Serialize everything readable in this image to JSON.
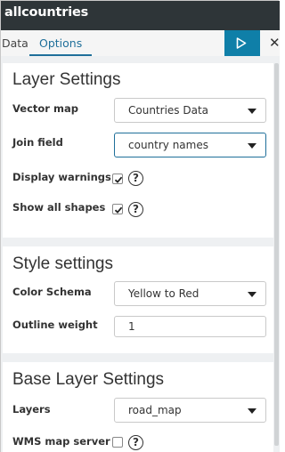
{
  "title": "allcountries",
  "tabs": [
    {
      "label": "Data"
    },
    {
      "label": "Options",
      "active": true
    }
  ],
  "icons": {
    "apply": "play-icon",
    "close": "close-icon"
  },
  "accent_color": "#0f7fa8",
  "sections": {
    "layer": {
      "title": "Layer Settings",
      "vector_map": {
        "label": "Vector map",
        "value": "Countries Data"
      },
      "join_field": {
        "label": "Join field",
        "value": "country names"
      },
      "display_warnings": {
        "label": "Display warnings",
        "checked": true
      },
      "show_all_shapes": {
        "label": "Show all shapes",
        "checked": true
      }
    },
    "style": {
      "title": "Style settings",
      "color_schema": {
        "label": "Color Schema",
        "value": "Yellow to Red"
      },
      "outline_weight": {
        "label": "Outline weight",
        "value": "1"
      }
    },
    "base": {
      "title": "Base Layer Settings",
      "layers": {
        "label": "Layers",
        "value": "road_map"
      },
      "wms_map_server": {
        "label": "WMS map server",
        "checked": false
      }
    }
  },
  "help_glyph": "?"
}
